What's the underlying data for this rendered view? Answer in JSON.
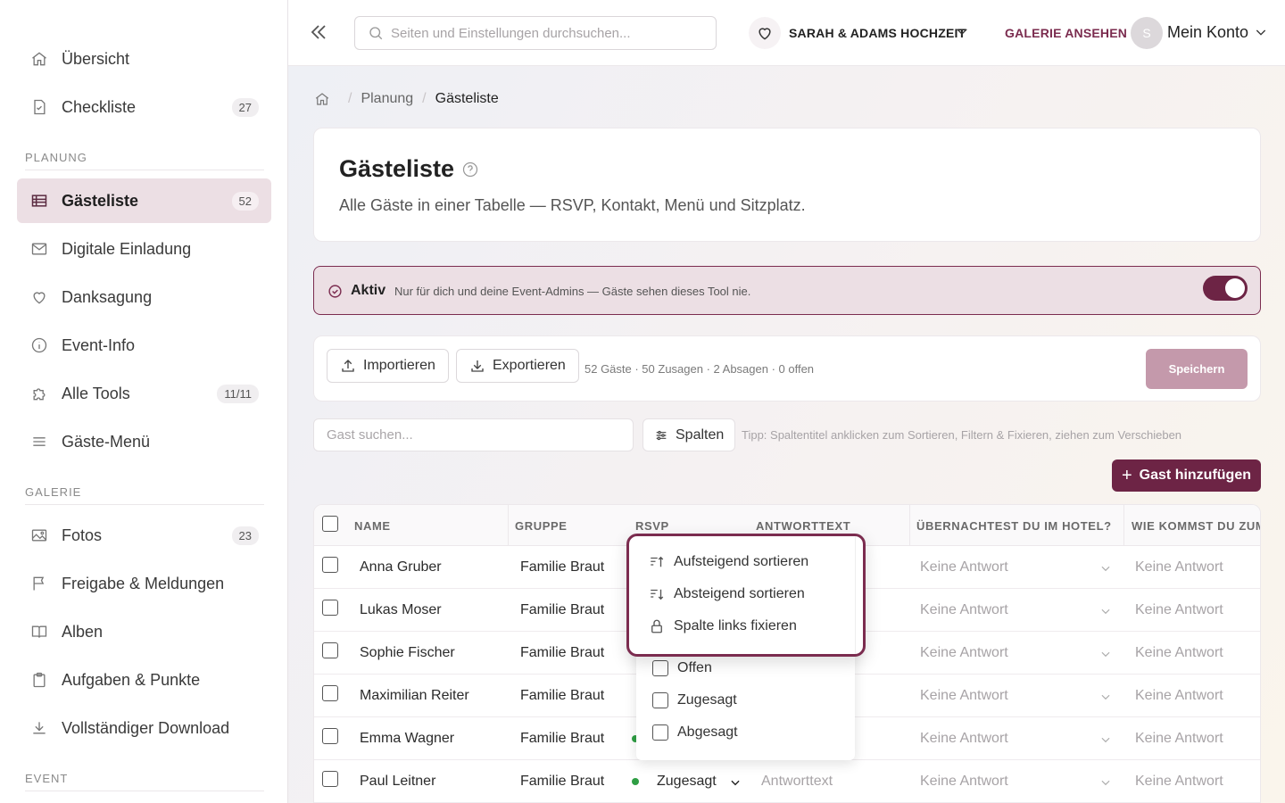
{
  "sidebar": {
    "items_top": [
      {
        "label": "Übersicht",
        "icon": "home-icon"
      },
      {
        "label": "Checkliste",
        "icon": "checklist-icon",
        "badge": "27"
      }
    ],
    "section_planung": "PLANUNG",
    "items_planung": [
      {
        "label": "Gästeliste",
        "icon": "table-icon",
        "badge": "52",
        "active": true
      },
      {
        "label": "Digitale Einladung",
        "icon": "mail-icon"
      },
      {
        "label": "Danksagung",
        "icon": "heart-icon"
      },
      {
        "label": "Event-Info",
        "icon": "info-icon"
      },
      {
        "label": "Alle Tools",
        "icon": "puzzle-icon",
        "badge": "11/11"
      },
      {
        "label": "Gäste-Menü",
        "icon": "menu-icon"
      }
    ],
    "section_galerie": "GALERIE",
    "items_galerie": [
      {
        "label": "Fotos",
        "icon": "image-icon",
        "badge": "23"
      },
      {
        "label": "Freigabe & Meldungen",
        "icon": "flag-icon"
      },
      {
        "label": "Alben",
        "icon": "book-icon"
      },
      {
        "label": "Aufgaben & Punkte",
        "icon": "clipboard-icon"
      },
      {
        "label": "Vollständiger Download",
        "icon": "download-icon"
      }
    ],
    "section_event": "EVENT"
  },
  "topbar": {
    "search_placeholder": "Seiten und Einstellungen durchsuchen...",
    "event_name": "SARAH & ADAMS HOCHZEIT",
    "gallery_link": "GALERIE ANSEHEN",
    "avatar_initial": "S",
    "account_label": "Mein Konto"
  },
  "breadcrumb": {
    "parent": "Planung",
    "current": "Gästeliste"
  },
  "header": {
    "title": "Gästeliste",
    "subtitle": "Alle Gäste in einer Tabelle — RSVP, Kontakt, Menü und Sitzplatz."
  },
  "active_bar": {
    "label": "Aktiv",
    "description": "Nur für dich und deine Event-Admins — Gäste sehen dieses Tool nie.",
    "enabled": true
  },
  "toolbar": {
    "import_label": "Importieren",
    "export_label": "Exportieren",
    "stats": "52 Gäste · 50 Zusagen · 2 Absagen · 0 offen",
    "save_label": "Speichern"
  },
  "filters": {
    "search_placeholder": "Gast suchen...",
    "columns_label": "Spalten",
    "tip": "Tipp: Spaltentitel anklicken zum Sortieren, Filtern & Fixieren, ziehen zum Verschieben",
    "add_guest_label": "Gast hinzufügen"
  },
  "table": {
    "headers": {
      "name": "NAME",
      "group": "GRUPPE",
      "rsvp": "RSVP",
      "answer": "ANTWORTTEXT",
      "hotel": "ÜBERNACHTEST DU IM HOTEL?",
      "travel": "WIE KOMMST DU ZUM"
    },
    "rows": [
      {
        "name": "Anna Gruber",
        "group": "Familie Braut",
        "hotel": "Keine Antwort",
        "travel": "Keine Antwort"
      },
      {
        "name": "Lukas Moser",
        "group": "Familie Braut",
        "hotel": "Keine Antwort",
        "travel": "Keine Antwort"
      },
      {
        "name": "Sophie Fischer",
        "group": "Familie Braut",
        "hotel": "Keine Antwort",
        "travel": "Keine Antwort"
      },
      {
        "name": "Maximilian Reiter",
        "group": "Familie Braut",
        "hotel": "Keine Antwort",
        "travel": "Keine Antwort"
      },
      {
        "name": "Emma Wagner",
        "group": "Familie Braut",
        "hotel": "Keine Antwort",
        "travel": "Keine Antwort"
      },
      {
        "name": "Paul Leitner",
        "group": "Familie Braut",
        "rsvp": "Zugesagt",
        "answer_placeholder": "Antworttext",
        "hotel": "Keine Antwort",
        "travel": "Keine Antwort"
      }
    ]
  },
  "sort_menu": {
    "items": [
      {
        "label": "Aufsteigend sortieren",
        "icon": "sort-asc-icon"
      },
      {
        "label": "Absteigend sortieren",
        "icon": "sort-desc-icon"
      },
      {
        "label": "Spalte links fixieren",
        "icon": "lock-icon"
      }
    ]
  },
  "rsvp_filter": {
    "options": [
      "Offen",
      "Zugesagt",
      "Abgesagt"
    ]
  },
  "colors": {
    "accent": "#6d2445",
    "accent_light": "#ecdfe4",
    "rsvp_green": "#2f9e44"
  }
}
